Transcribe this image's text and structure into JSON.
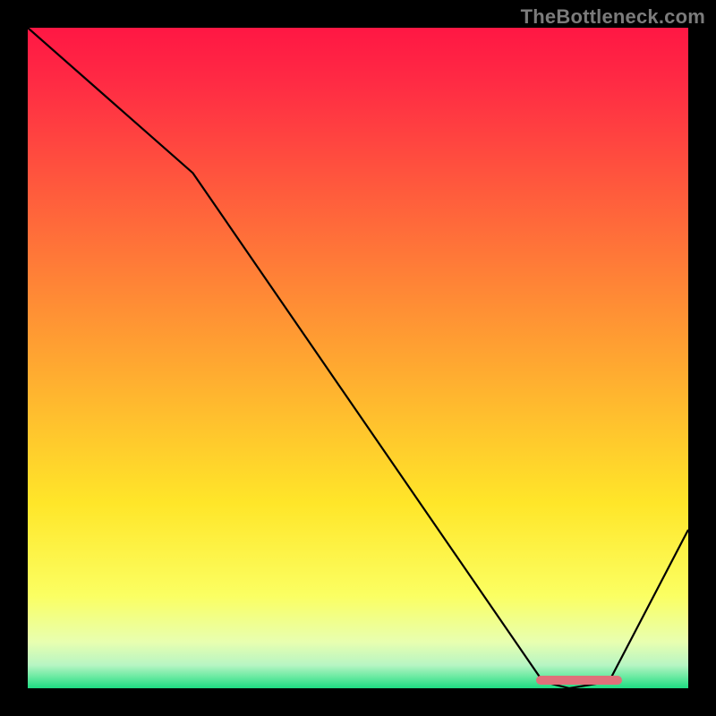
{
  "watermark": "TheBottleneck.com",
  "chart_data": {
    "type": "line",
    "title": "",
    "xlabel": "",
    "ylabel": "",
    "xlim": [
      0,
      100
    ],
    "ylim": [
      0,
      100
    ],
    "grid": false,
    "series": [
      {
        "name": "bottleneck-curve",
        "x": [
          0,
          25,
          78,
          82,
          88,
          100
        ],
        "y": [
          100,
          78,
          1,
          0,
          1,
          24
        ],
        "color": "#000000"
      }
    ],
    "marker": {
      "name": "optimal-range",
      "x_start": 77,
      "x_end": 90,
      "y": 1.2,
      "color": "#e0707a"
    },
    "background_gradient_stops": [
      {
        "offset": 0.0,
        "color": "#ff1744"
      },
      {
        "offset": 0.08,
        "color": "#ff2a44"
      },
      {
        "offset": 0.5,
        "color": "#ffa531"
      },
      {
        "offset": 0.72,
        "color": "#ffe629"
      },
      {
        "offset": 0.86,
        "color": "#fbff62"
      },
      {
        "offset": 0.93,
        "color": "#e8ffb0"
      },
      {
        "offset": 0.965,
        "color": "#b7f5c3"
      },
      {
        "offset": 0.985,
        "color": "#5fe89d"
      },
      {
        "offset": 1.0,
        "color": "#1edb82"
      }
    ]
  }
}
